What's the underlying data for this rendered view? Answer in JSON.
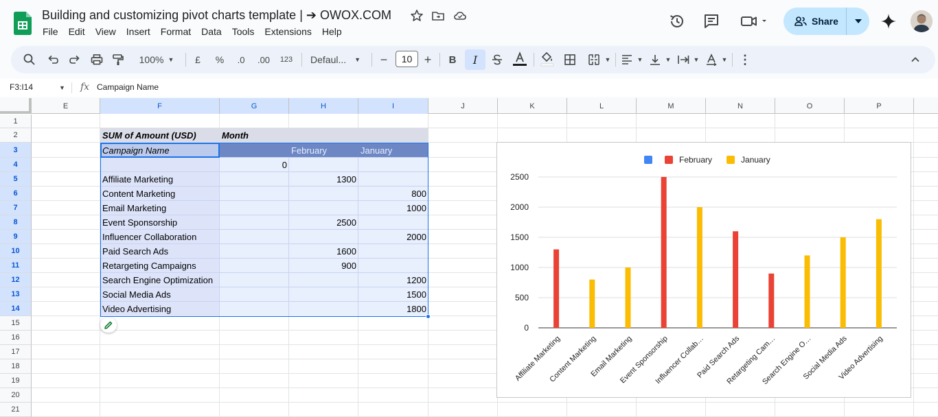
{
  "doc": {
    "title": "Building and customizing pivot charts template | ➔ OWOX.COM"
  },
  "menu": [
    "File",
    "Edit",
    "View",
    "Insert",
    "Format",
    "Data",
    "Tools",
    "Extensions",
    "Help"
  ],
  "share": {
    "label": "Share"
  },
  "toolbar": {
    "zoom": "100%",
    "currency": "£",
    "percent": "%",
    "dec_decrease": ".0",
    "dec_increase": ".00",
    "number_format": "123",
    "font": "Defaul...",
    "font_size": "10",
    "bold": "B",
    "italic": "I"
  },
  "formula_bar": {
    "name_box": "F3:I14",
    "fx": "fx",
    "value": "Campaign Name"
  },
  "colors": {
    "accent": "#1a73e8",
    "february": "#ea4335",
    "january": "#fbbc04",
    "blank_series": "#4285f4"
  },
  "columns": [
    "E",
    "F",
    "G",
    "H",
    "I",
    "J",
    "K",
    "L",
    "M",
    "N",
    "O",
    "P"
  ],
  "rows": [
    "1",
    "2",
    "3",
    "4",
    "5",
    "6",
    "7",
    "8",
    "9",
    "10",
    "11",
    "12",
    "13",
    "14",
    "15",
    "16",
    "17",
    "18",
    "19",
    "20",
    "21"
  ],
  "pivot": {
    "header_value": "SUM of Amount (USD)",
    "header_month": "Month",
    "row_label": "Campaign Name",
    "col_february": "February",
    "col_january": "January",
    "blank_value": "0",
    "rows": [
      {
        "name": "Affiliate Marketing",
        "feb": "1300",
        "jan": ""
      },
      {
        "name": "Content Marketing",
        "feb": "",
        "jan": "800"
      },
      {
        "name": "Email Marketing",
        "feb": "",
        "jan": "1000"
      },
      {
        "name": "Event Sponsorship",
        "feb": "2500",
        "jan": ""
      },
      {
        "name": "Influencer Collaboration",
        "feb": "",
        "jan": "2000"
      },
      {
        "name": "Paid Search Ads",
        "feb": "1600",
        "jan": ""
      },
      {
        "name": "Retargeting Campaigns",
        "feb": "900",
        "jan": ""
      },
      {
        "name": "Search Engine Optimization",
        "feb": "",
        "jan": "1200"
      },
      {
        "name": "Social Media Ads",
        "feb": "",
        "jan": "1500"
      },
      {
        "name": "Video Advertising",
        "feb": "",
        "jan": "1800"
      }
    ]
  },
  "chart_data": {
    "type": "bar",
    "title": "",
    "xlabel": "",
    "ylabel": "",
    "ylim": [
      0,
      2500
    ],
    "yticks": [
      0,
      500,
      1000,
      1500,
      2000,
      2500
    ],
    "grid": true,
    "legend": "top",
    "legend_entries": [
      "",
      "February",
      "January"
    ],
    "categories": [
      "Affiliate Marketing",
      "Content Marketing",
      "Email Marketing",
      "Event Sponsorship",
      "Influencer Collab…",
      "Paid Search Ads",
      "Retargeting Cam…",
      "Search Engine O…",
      "Social Media Ads",
      "Video Advertising"
    ],
    "series": [
      {
        "name": "",
        "color": "#4285f4",
        "values": [
          0,
          0,
          0,
          0,
          0,
          0,
          0,
          0,
          0,
          0
        ]
      },
      {
        "name": "February",
        "color": "#ea4335",
        "values": [
          1300,
          0,
          0,
          2500,
          0,
          1600,
          900,
          0,
          0,
          0
        ]
      },
      {
        "name": "January",
        "color": "#fbbc04",
        "values": [
          0,
          800,
          1000,
          0,
          2000,
          0,
          0,
          1200,
          1500,
          1800
        ]
      }
    ]
  }
}
